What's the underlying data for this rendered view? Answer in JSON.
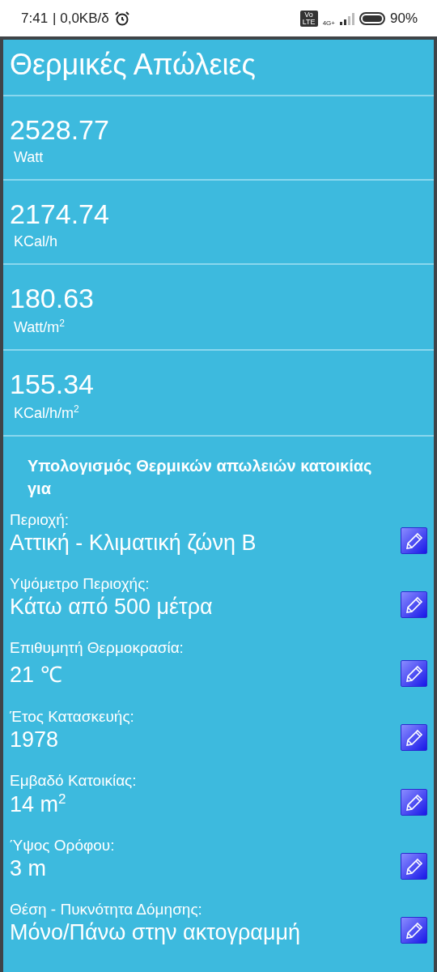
{
  "status_bar": {
    "time": "7:41",
    "speed": "| 0,0KB/δ",
    "volte": "Vo LTE",
    "network": "4G+",
    "battery": "90%"
  },
  "title": "Θερμικές Απώλειες",
  "results": [
    {
      "value": "2528.77",
      "unit": "Watt"
    },
    {
      "value": "2174.74",
      "unit": "KCal/h"
    },
    {
      "value": "180.63",
      "unit": "Watt/m$^{2}$"
    },
    {
      "value": "155.34",
      "unit": "KCal/h/m$^{2}$"
    }
  ],
  "section_heading": "Υπολογισμός Θερμικών απωλειών κατοικίας για",
  "parameters": [
    {
      "label": "Περιοχή:",
      "value": "Αττική - Κλιματική ζώνη Β"
    },
    {
      "label": "Υψόμετρο Περιοχής:",
      "value": "Κάτω από 500 μέτρα"
    },
    {
      "label": "Επιθυμητή Θερμοκρασία:",
      "value": "21 ℃"
    },
    {
      "label": "Έτος Κατασκευής:",
      "value": "1978"
    },
    {
      "label": "Εμβαδό Κατοικίας:",
      "value": "14 m$^{2}$"
    },
    {
      "label": "Ύψος Ορόφου:",
      "value": "3 m"
    },
    {
      "label": "Θέση - Πυκνότητα Δόμησης:",
      "value": "Μόνο/Πάνω στην ακτογραμμή"
    }
  ]
}
